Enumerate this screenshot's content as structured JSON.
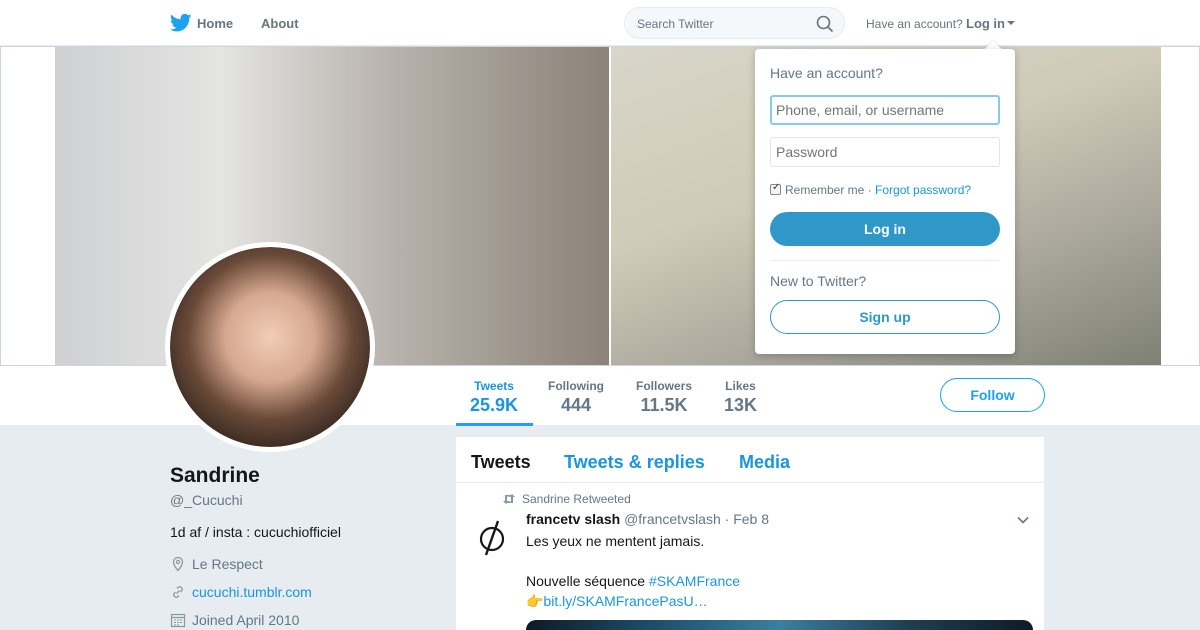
{
  "nav": {
    "home_label": "Home",
    "about_label": "About",
    "search_placeholder": "Search Twitter",
    "have_account": "Have an account?",
    "login_label": "Log in"
  },
  "profile": {
    "name": "Sandrine",
    "handle": "@_Cucuchi",
    "bio": "1d af / insta : cucuchiofficiel",
    "location": "Le Respect",
    "website": "cucuchi.tumblr.com",
    "joined": "Joined April 2010"
  },
  "stats": {
    "tweets_label": "Tweets",
    "tweets_value": "25.9K",
    "following_label": "Following",
    "following_value": "444",
    "followers_label": "Followers",
    "followers_value": "11.5K",
    "likes_label": "Likes",
    "likes_value": "13K"
  },
  "follow_label": "Follow",
  "timeline": {
    "tabs": [
      "Tweets",
      "Tweets & replies",
      "Media"
    ],
    "retweet_by": "Sandrine Retweeted",
    "tweet": {
      "author": "francetv slash",
      "handle": "@francetvslash",
      "date": "· Feb 8",
      "line1": "Les yeux ne mentent jamais.",
      "line2_prefix": "Nouvelle séquence ",
      "hashtag": "#SKAMFrance",
      "link": "👉bit.ly/SKAMFrancePasU…"
    }
  },
  "login_dropdown": {
    "title": "Have an account?",
    "username_placeholder": "Phone, email, or username",
    "password_placeholder": "Password",
    "remember_label": "Remember me",
    "separator": " · ",
    "forgot_label": "Forgot password?",
    "login_button": "Log in",
    "new_label": "New to Twitter?",
    "signup_button": "Sign up"
  },
  "colors": {
    "accent": "#1da1f2",
    "link": "#1b95e0",
    "login_button": "#3098c8"
  }
}
